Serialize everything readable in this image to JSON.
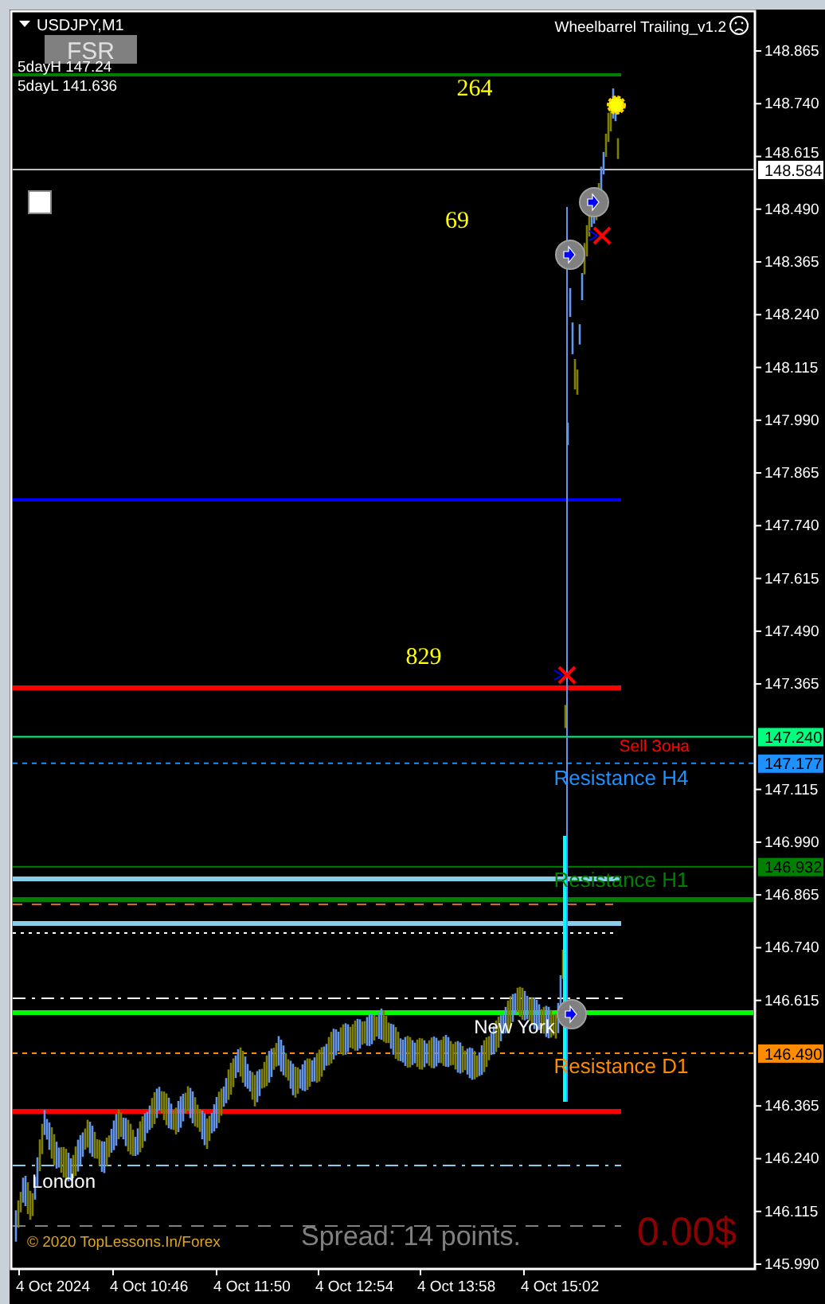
{
  "chart": {
    "symbol": "USDJPY,M1",
    "expert": "Wheelbarrel Trailing_v1.2",
    "fsr_button": "FSR",
    "five_day_high": "5dayH 147.24",
    "five_day_low": "5dayL 141.636",
    "counts": [
      "264",
      "69",
      "829"
    ],
    "zones": [
      {
        "kind": "sell",
        "label": "Sell Зона",
        "color": "#ff0000"
      },
      {
        "kind": "resistance",
        "label": "Resistance H4",
        "color": "#1e90ff"
      },
      {
        "kind": "resistance",
        "label": "Resistance H1",
        "color": "#008000"
      },
      {
        "kind": "resistance",
        "label": "Resistance D1",
        "color": "#ff8c00"
      }
    ],
    "sessions": [
      "New York",
      "London"
    ],
    "copyright": "© 2020 TopLessons.In/Forex",
    "spread": "Spread: 14 points.",
    "profit": "0.00$",
    "price_ticks": [
      "148.865",
      "148.740",
      "148.615",
      "148.490",
      "148.365",
      "148.240",
      "148.115",
      "147.990",
      "147.865",
      "147.740",
      "147.615",
      "147.490",
      "147.365",
      "147.115",
      "146.990",
      "146.865",
      "146.740",
      "146.615",
      "146.365",
      "146.240",
      "146.115",
      "145.990"
    ],
    "current_price": "148.584",
    "levels": [
      {
        "price": "147.240",
        "color": "#00ff7f"
      },
      {
        "price": "147.177",
        "color": "#1e90ff"
      },
      {
        "price": "146.932",
        "color": "#008000"
      },
      {
        "price": "146.490",
        "color": "#ff8c00"
      }
    ],
    "time_ticks": [
      "4 Oct 2024",
      "4 Oct 10:46",
      "4 Oct 11:50",
      "4 Oct 12:54",
      "4 Oct 13:58",
      "4 Oct 15:02"
    ]
  }
}
